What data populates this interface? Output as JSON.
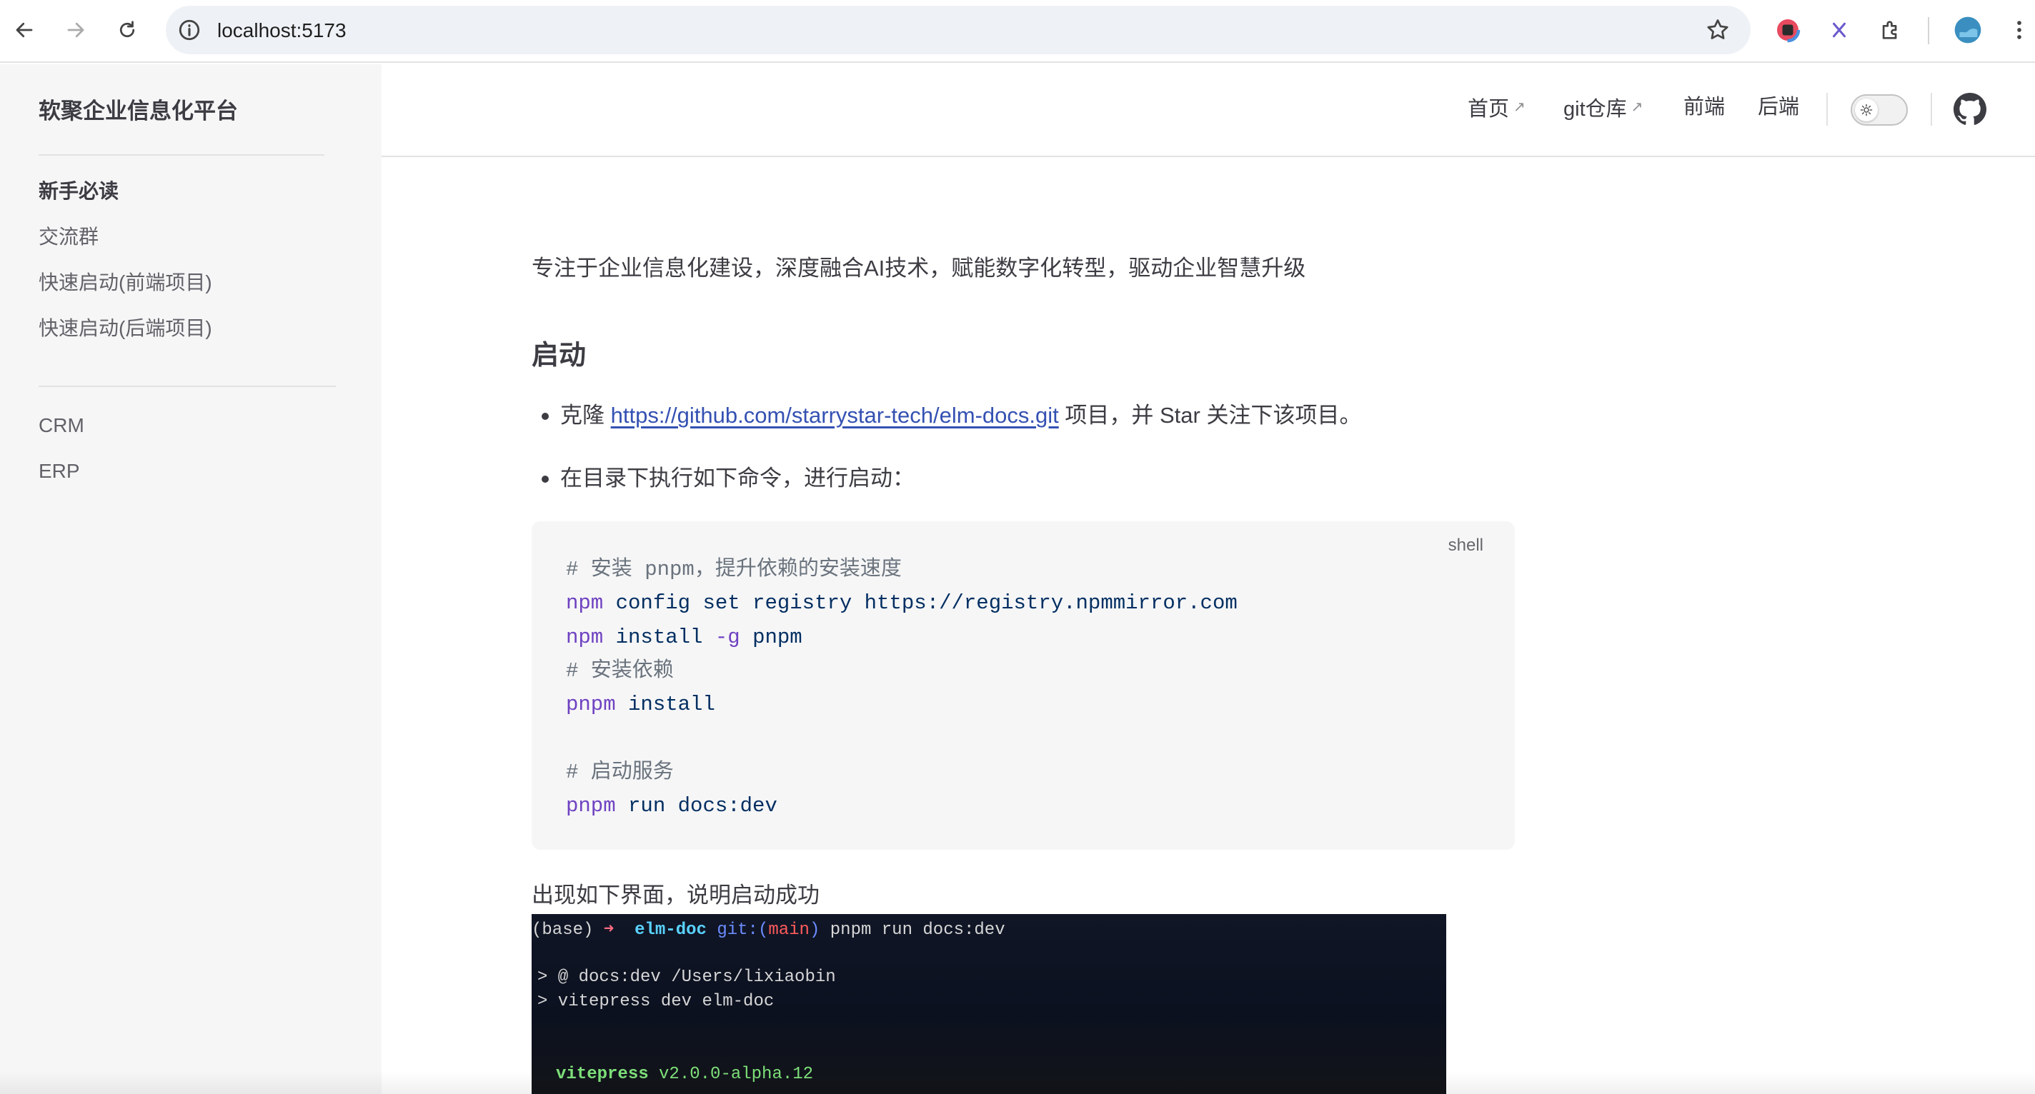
{
  "browser": {
    "url": "localhost:5173"
  },
  "sidebar": {
    "title": "软聚企业信息化平台",
    "group1": [
      "新手必读",
      "交流群",
      "快速启动(前端项目)",
      "快速启动(后端项目)"
    ],
    "group2": [
      "CRM",
      "ERP"
    ]
  },
  "topnav": {
    "links": [
      {
        "label": "首页",
        "external": true
      },
      {
        "label": "git仓库",
        "external": true
      },
      {
        "label": "前端",
        "external": false
      },
      {
        "label": "后端",
        "external": false
      }
    ]
  },
  "content": {
    "lead": "专注于企业信息化建设，深度融合AI技术，赋能数字化转型，驱动企业智慧升级",
    "heading": "启动",
    "bullet1_prefix": "克隆 ",
    "bullet1_link": "https://github.com/starrystar-tech/elm-docs.git",
    "bullet1_suffix": " 项目，并 Star 关注下该项目。",
    "bullet2": "在目录下执行如下命令，进行启动：",
    "code_lang": "shell",
    "code": {
      "c1": "# 安装 pnpm，提升依赖的安装速度",
      "l2_cmd": "npm",
      "l2_rest": " config set registry https://registry.npmmirror.com",
      "l3_cmd": "npm",
      "l3_a": " install ",
      "l3_flag": "-g",
      "l3_b": " pnpm",
      "c4": "# 安装依赖",
      "l5_cmd": "pnpm",
      "l5_rest": " install",
      "c7": "# 启动服务",
      "l8_cmd": "pnpm",
      "l8_rest": " run docs:dev"
    },
    "after_code": "出现如下界面，说明启动成功",
    "terminal": {
      "prompt_base": "(base) ",
      "prompt_arrow": "➜",
      "prompt_dir": "elm-doc",
      "prompt_git": "git:(",
      "prompt_branch": "main",
      "prompt_close": ")",
      "prompt_cmd": " pnpm run docs:dev",
      "line2": "> @ docs:dev /Users/lixiaobin",
      "line3": "> vitepress dev elm-doc",
      "vp_name": "vitepress",
      "vp_version": " v2.0.0-alpha.12"
    }
  }
}
